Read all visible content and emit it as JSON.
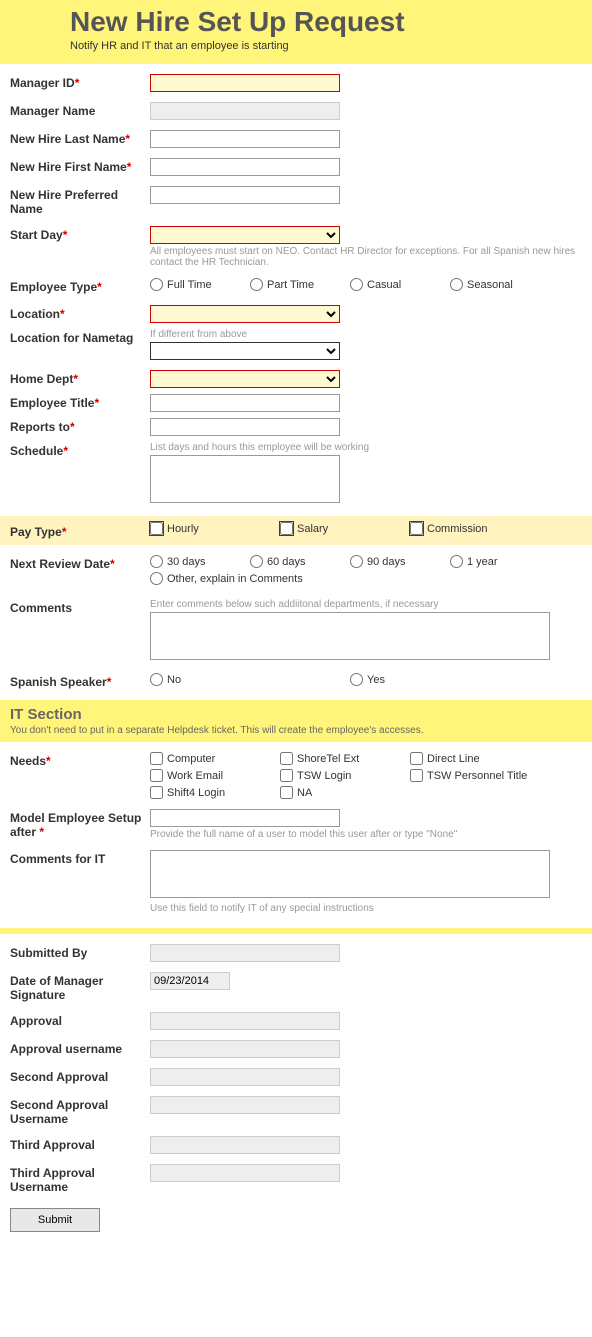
{
  "header": {
    "title": "New Hire Set Up Request",
    "subtitle": "Notify HR and IT that an employee is starting"
  },
  "labels": {
    "manager_id": "Manager ID",
    "manager_name": "Manager Name",
    "last_name": "New Hire Last Name",
    "first_name": "New Hire First Name",
    "preferred_name": "New Hire Preferred Name",
    "start_day": "Start Day",
    "employee_type": "Employee Type",
    "location": "Location",
    "location_nametag": "Location for Nametag",
    "home_dept": "Home Dept",
    "employee_title": "Employee Title",
    "reports_to": "Reports to",
    "schedule": "Schedule",
    "pay_type": "Pay Type",
    "next_review": "Next Review Date",
    "comments": "Comments",
    "spanish": "Spanish Speaker",
    "it_section": "IT Section",
    "needs": "Needs",
    "model_after": "Model Employee Setup after ",
    "comments_it": "Comments for IT",
    "submitted_by": "Submitted By",
    "date_sig": "Date of Manager Signature",
    "approval": "Approval",
    "approval_user": "Approval username",
    "second_approval": "Second Approval",
    "second_approval_user": "Second Approval Username",
    "third_approval": "Third Approval",
    "third_approval_user": "Third Approval Username"
  },
  "helpers": {
    "start_day": "All employees must start on NEO. Contact HR Director for exceptions. For all Spanish new hires contact the HR Technician.",
    "location_nametag": "If different from above",
    "schedule": "List days and hours this employee will be working",
    "comments": "Enter comments below such addiitonal departments, if necessary",
    "it_section": "You don't need to put in a separate Helpdesk ticket. This will create the employee's accesses.",
    "model_after": "Provide the full name of a user to model this user after or type \"None\"",
    "comments_it": "Use this field to notify IT of any special instructions"
  },
  "options": {
    "employee_type": [
      "Full Time",
      "Part Time",
      "Casual",
      "Seasonal"
    ],
    "pay_type": [
      "Hourly",
      "Salary",
      "Commission"
    ],
    "next_review": [
      "30 days",
      "60 days",
      "90 days",
      "1 year",
      "Other, explain in Comments"
    ],
    "spanish": [
      "No",
      "Yes"
    ],
    "needs": [
      "Computer",
      "ShoreTel Ext",
      "Direct Line",
      "Work Email",
      "TSW Login",
      "TSW Personnel Title",
      "Shift4 Login",
      "NA"
    ]
  },
  "values": {
    "date_sig": "09/23/2014"
  },
  "buttons": {
    "submit": "Submit"
  }
}
